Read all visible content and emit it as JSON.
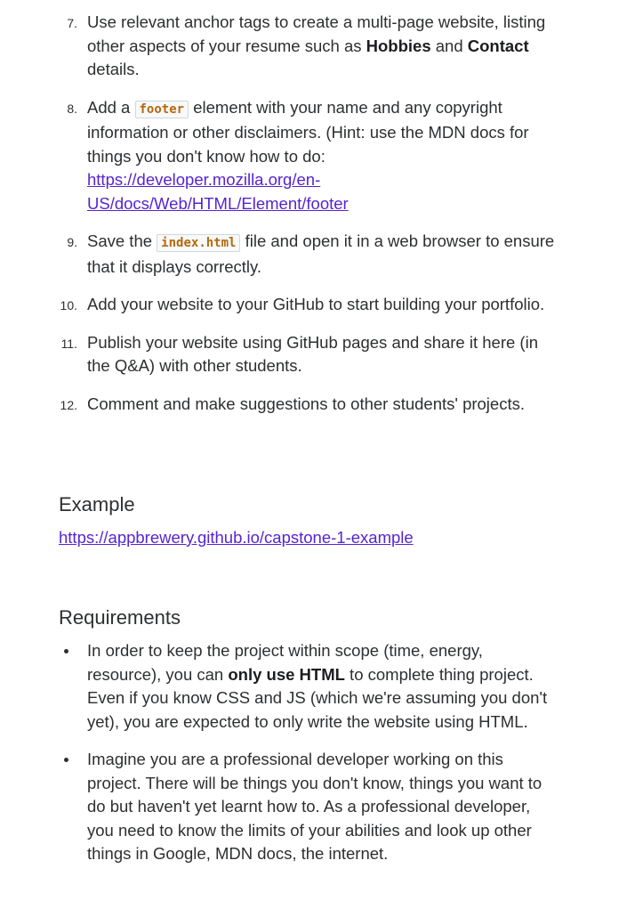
{
  "steps": [
    {
      "num": "7.",
      "t1": "Use relevant anchor tags to create a multi-page website, listing other aspects of your resume such as ",
      "b1": "Hobbies",
      "t2": " and ",
      "b2": "Contact",
      "t3": " details."
    },
    {
      "num": "8.",
      "t1": "Add a ",
      "code": "footer",
      "t2": " element with your name and any copyright information or other disclaimers. (Hint: use the MDN docs for things you don't know how to do: ",
      "link": "https://developer.mozilla.org/en-US/docs/Web/HTML/Element/footer"
    },
    {
      "num": "9.",
      "t1": "Save the ",
      "code": "index.html",
      "t2": " file and open it in a web browser to ensure that it displays correctly."
    },
    {
      "num": "10.",
      "t1": "Add your website to your GitHub to start building your portfolio."
    },
    {
      "num": "11.",
      "t1": "Publish your website using GitHub pages and share it here (in the Q&A) with other students."
    },
    {
      "num": "12.",
      "t1": "Comment and make suggestions to other students' projects."
    }
  ],
  "example": {
    "title": "Example",
    "link": "https://appbrewery.github.io/capstone-1-example"
  },
  "requirements": {
    "title": "Requirements",
    "items": [
      {
        "t1": "In order to keep the project within scope (time, energy, resource), you can ",
        "b1": "only use HTML",
        "t2": " to complete thing project. Even if you know CSS and JS (which we're assuming you don't yet), you are expected to only write the website using HTML."
      },
      {
        "t1": "Imagine you are a professional developer working on this project. There will be things you don't know, things you want to do but haven't yet learnt how to. As a professional developer, you need to know the limits of your abilities and look up other things in Google, MDN docs, the internet."
      }
    ]
  },
  "colors": {
    "text": "#2d2f31",
    "link": "#5624d0",
    "code_text": "#b4690e",
    "code_bg": "#f7f9fa"
  }
}
